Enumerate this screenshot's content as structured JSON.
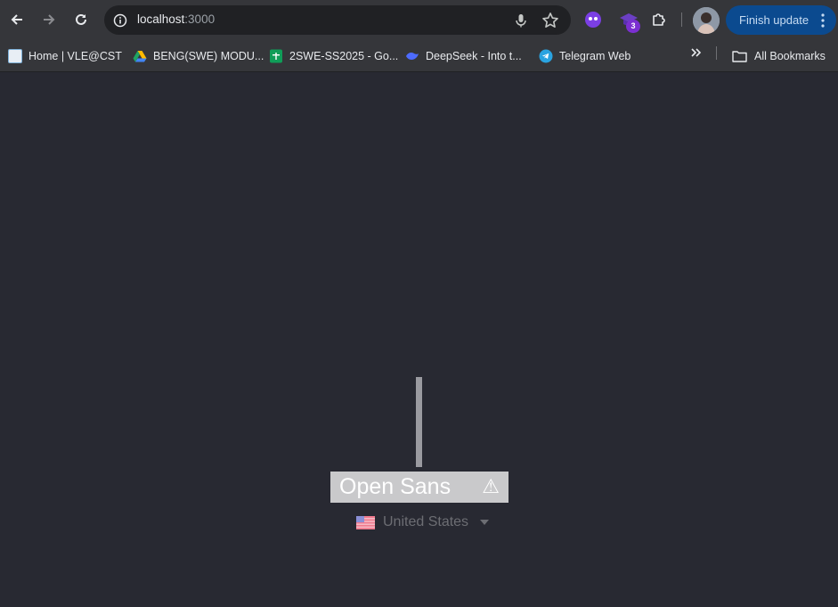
{
  "browser": {
    "url_host": "localhost",
    "url_port": ":3000",
    "update_button_label": "Finish update",
    "extension_badge_count": "3"
  },
  "bookmarks": {
    "items": [
      {
        "label": "Home | VLE@CST",
        "icon": "vle-favicon",
        "color": "#7fb2d9"
      },
      {
        "label": "BENG(SWE) MODU...",
        "icon": "google-drive-icon",
        "color": "#1fa463"
      },
      {
        "label": "2SWE-SS2025 - Go...",
        "icon": "google-sheets-icon",
        "color": "#0f9d58"
      },
      {
        "label": "DeepSeek - Into t...",
        "icon": "deepseek-icon",
        "color": "#4d6bfe"
      },
      {
        "label": "Telegram Web",
        "icon": "telegram-icon",
        "color": "#2aa3e0"
      }
    ],
    "all_bookmarks_label": "All Bookmarks"
  },
  "page": {
    "font_name": "Open Sans",
    "warning_glyph": "⚠",
    "locale_label": "United States",
    "colors": {
      "background": "#282932",
      "badge": "#c9c9cb",
      "bar": "#9a9aa0"
    }
  }
}
